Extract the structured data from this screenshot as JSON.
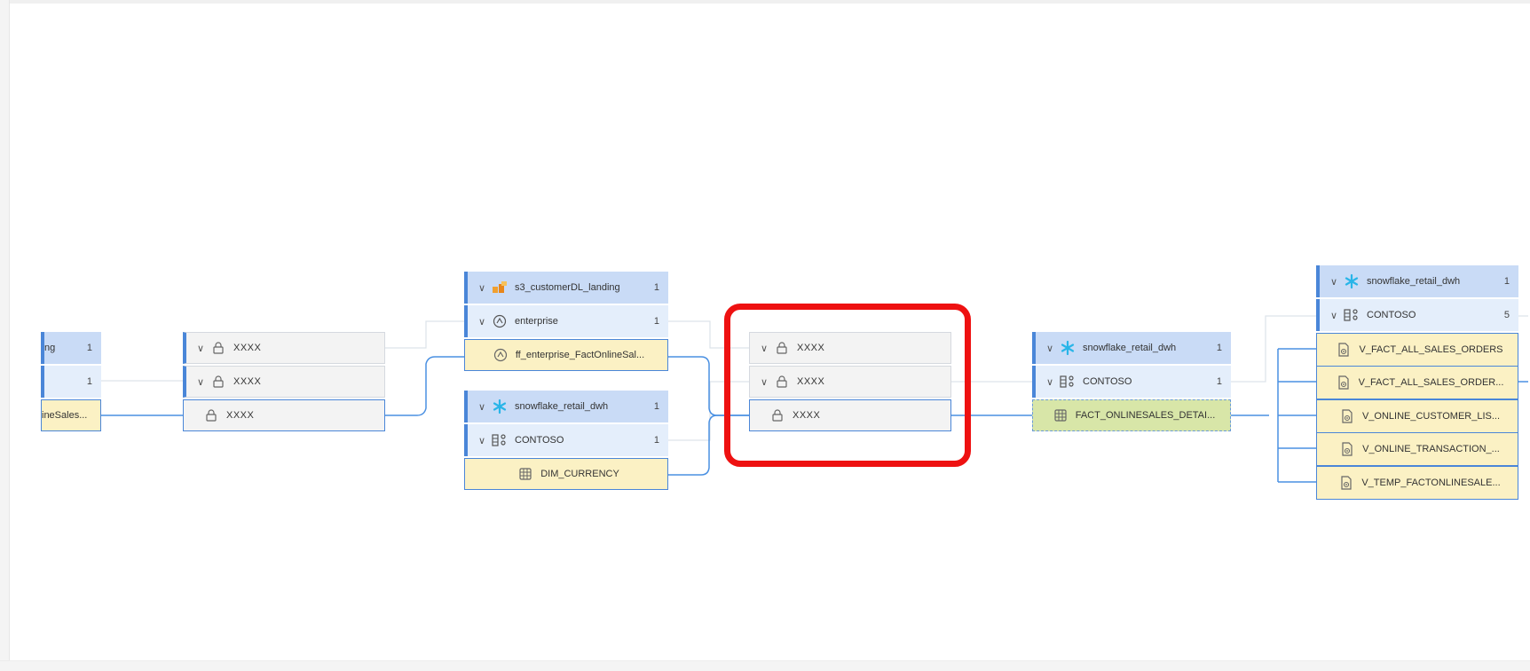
{
  "lineage": {
    "node_a": {
      "header": {
        "label": "ng",
        "count": "1"
      },
      "sub": {
        "label": "",
        "count": "1"
      },
      "leaf": {
        "label": "ineSales..."
      }
    },
    "node_b": {
      "row1": {
        "label": "XXXX"
      },
      "row2": {
        "label": "XXXX"
      },
      "leaf": {
        "label": "XXXX"
      }
    },
    "node_c": {
      "header": {
        "label": "s3_customerDL_landing",
        "count": "1"
      },
      "sub": {
        "label": "enterprise",
        "count": "1"
      },
      "leaf": {
        "label": "ff_enterprise_FactOnlineSal..."
      }
    },
    "node_d": {
      "header": {
        "label": "snowflake_retail_dwh",
        "count": "1"
      },
      "sub": {
        "label": "CONTOSO",
        "count": "1"
      },
      "leaf": {
        "label": "DIM_CURRENCY"
      }
    },
    "node_e": {
      "row1": {
        "label": "XXXX"
      },
      "row2": {
        "label": "XXXX"
      },
      "leaf": {
        "label": "XXXX"
      }
    },
    "node_f": {
      "header": {
        "label": "snowflake_retail_dwh",
        "count": "1"
      },
      "sub": {
        "label": "CONTOSO",
        "count": "1"
      },
      "leaf": {
        "label": "FACT_ONLINESALES_DETAI..."
      }
    },
    "node_g": {
      "header": {
        "label": "snowflake_retail_dwh",
        "count": "1"
      },
      "sub": {
        "label": "CONTOSO",
        "count": "5"
      },
      "views": [
        {
          "label": "V_FACT_ALL_SALES_ORDERS"
        },
        {
          "label": "V_FACT_ALL_SALES_ORDER..."
        },
        {
          "label": "V_ONLINE_CUSTOMER_LIS..."
        },
        {
          "label": "V_ONLINE_TRANSACTION_..."
        },
        {
          "label": "V_TEMP_FACTONLINESALE..."
        }
      ]
    }
  },
  "icons": {
    "chevron": "chevron-down-icon",
    "lock": "lock-icon",
    "s3": "s3-bucket-icon",
    "dataset": "dataset-icon",
    "snowflake": "snowflake-icon",
    "schema": "schema-icon",
    "table": "table-icon",
    "view": "view-icon"
  },
  "colors": {
    "header_bg": "#c9dbf6",
    "sub_bg": "#e4eefb",
    "accent": "#4a86d8",
    "leaf_yellow": "#fbf1c4",
    "leaf_green": "#d8e6a8",
    "highlight": "#ee1111"
  }
}
